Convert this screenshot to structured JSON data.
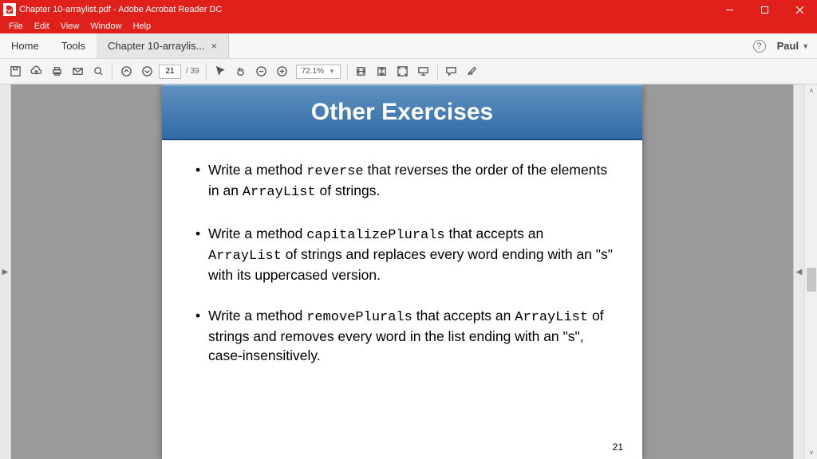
{
  "window": {
    "title": "Chapter 10-arraylist.pdf - Adobe Acrobat Reader DC"
  },
  "menu": {
    "file": "File",
    "edit": "Edit",
    "view": "View",
    "window": "Window",
    "help": "Help"
  },
  "tabs": {
    "home": "Home",
    "tools": "Tools",
    "doc": "Chapter 10-arraylis...",
    "user": "Paul"
  },
  "toolbar": {
    "page_current": "21",
    "page_total": "/ 39",
    "zoom": "72.1%"
  },
  "slide": {
    "title": "Other Exercises",
    "bullets": [
      {
        "pre1": "Write a method ",
        "code1": "reverse",
        "post1": " that reverses the order of the elements in an ",
        "code2": "ArrayList",
        "post2": " of strings."
      },
      {
        "pre1": "Write a method ",
        "code1": "capitalizePlurals",
        "post1": " that accepts an ",
        "code2": "ArrayList",
        "post2": " of strings and replaces every word ending with an \"s\" with its uppercased version."
      },
      {
        "pre1": "Write a method ",
        "code1": "removePlurals",
        "post1": " that accepts an ",
        "code2": "ArrayList",
        "post2": " of strings and removes every word in the list ending with an \"s\", case-insensitively."
      }
    ],
    "page_number": "21"
  }
}
